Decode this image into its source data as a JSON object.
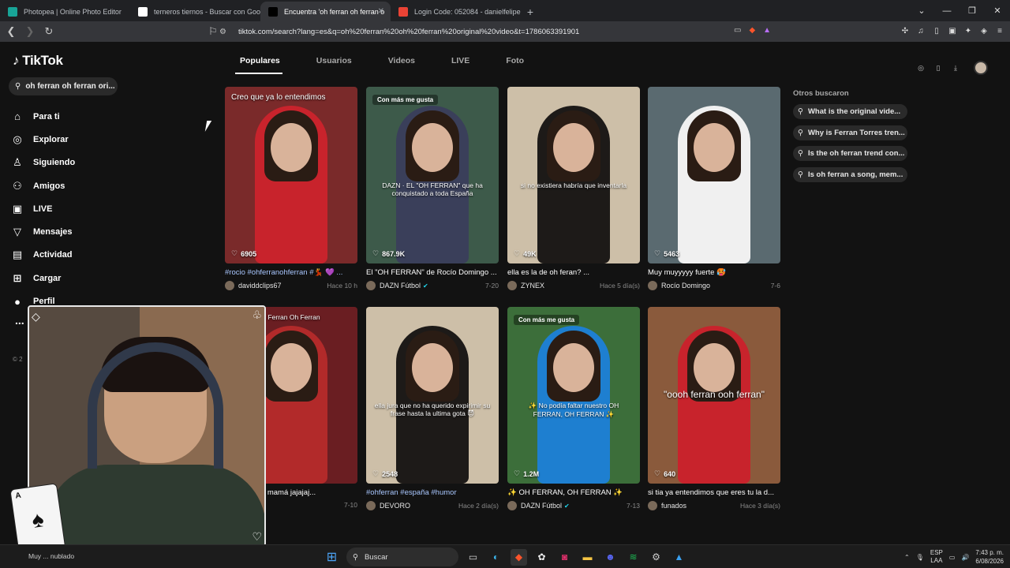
{
  "browser": {
    "tabs": [
      {
        "title": "Photopea | Online Photo Editor",
        "favicon_color": "#18a497",
        "active": false
      },
      {
        "title": "terneros tiernos - Buscar con Google",
        "favicon_color": "#ffffff",
        "active": false
      },
      {
        "title": "Encuentra 'oh ferran oh ferran o",
        "favicon_color": "#000000",
        "active": true
      },
      {
        "title": "Login Code: 052084 - danielfelipega",
        "favicon_color": "#ea4335",
        "active": false
      }
    ],
    "new_tab": "+",
    "url": "tiktok.com/search?lang=es&q=oh%20ferran%20oh%20ferran%20original%20video&t=1786063391901"
  },
  "sidebar": {
    "logo": "TikTok",
    "search_value": "oh ferran oh ferran ori...",
    "items": [
      {
        "label": "Para ti",
        "icon": "home-icon"
      },
      {
        "label": "Explorar",
        "icon": "compass-icon"
      },
      {
        "label": "Siguiendo",
        "icon": "following-icon"
      },
      {
        "label": "Amigos",
        "icon": "friends-icon"
      },
      {
        "label": "LIVE",
        "icon": "live-icon"
      },
      {
        "label": "Mensajes",
        "icon": "messages-icon"
      },
      {
        "label": "Actividad",
        "icon": "activity-icon"
      },
      {
        "label": "Cargar",
        "icon": "upload-icon"
      },
      {
        "label": "Perfil",
        "icon": "profile-icon"
      }
    ],
    "more": "...",
    "footer": "© 2"
  },
  "search_tabs": [
    "Populares",
    "Usuarios",
    "Videos",
    "LIVE",
    "Foto"
  ],
  "videos": [
    {
      "caption": "#rocio #ohferranohferran #💃 💜 ...",
      "user": "daviddclips67",
      "verified": false,
      "date": "Hace 10 h",
      "likes": "6905",
      "badge": "",
      "overlay": "Creo que ya lo entendimos",
      "bg": "#7a2a2a",
      "outfit": "#c8232c"
    },
    {
      "caption": "El \"OH FERRAN\" de Rocío Domingo ...",
      "user": "DAZN Fútbol",
      "verified": true,
      "date": "7-20",
      "likes": "867.9K",
      "badge": "Con más me gusta",
      "overlay": "DAZN · EL \"OH FERRAN\" que ha conquistado a toda España",
      "bg": "#3d5a4a",
      "outfit": "#3a3f5a"
    },
    {
      "caption": "ella es la de oh feran? ...",
      "user": "ZYNEX",
      "verified": false,
      "date": "Hace 5 día(s)",
      "likes": "49K",
      "badge": "",
      "overlay": "si no existiera habría que inventarla",
      "bg": "#cdbfa8",
      "outfit": "#1d1a18"
    },
    {
      "caption": "Muy muyyyyy fuerte 🥵",
      "user": "Rocío Domingo",
      "verified": false,
      "date": "7-6",
      "likes": "5463",
      "badge": "",
      "overlay": "",
      "bg": "#5a6a70",
      "outfit": "#f0f0f0"
    },
    {
      "caption": "o ser casi tu mamá jajajaj...",
      "user": "",
      "verified": false,
      "date": "7-10",
      "likes": "",
      "badge": "",
      "overlay": "h Ferran Oh Ferran",
      "bg": "#6a1e22",
      "outfit": "#b22a2a"
    },
    {
      "caption": "#ohferran #españa #humor",
      "user": "DEVORO",
      "verified": false,
      "date": "Hace 2 día(s)",
      "likes": "2548",
      "badge": "",
      "overlay": "ella jura que no ha querido expirimir su frase hasta la ultima gota 😈",
      "bg": "#cdbfa8",
      "outfit": "#1d1a18"
    },
    {
      "caption": "✨ OH FERRAN, OH FERRAN ✨",
      "user": "DAZN Fútbol",
      "verified": true,
      "date": "7-13",
      "likes": "1.2M",
      "badge": "Con más me gusta",
      "overlay": "✨ No podía faltar nuestro OH FERRAN, OH FERRAN ✨",
      "bg": "#3c6e3a",
      "outfit": "#1e7fd0"
    },
    {
      "caption": "si tia ya entendimos que eres tu la d...",
      "user": "funados",
      "verified": false,
      "date": "Hace 3 día(s)",
      "likes": "640",
      "badge": "",
      "overlay": "\"oooh ferran ooh ferran\"",
      "bg": "#8a5a3c",
      "outfit": "#c8232c"
    }
  ],
  "others": {
    "heading": "Otros buscaron",
    "items": [
      "What is the original vide...",
      "Why is Ferran Torres tren...",
      "Is the oh ferran trend con...",
      "Is oh ferran a song, mem..."
    ]
  },
  "taskbar": {
    "left_text": "Muy ... nublado",
    "search": "Buscar",
    "lang_top": "ESP",
    "lang_bottom": "LAA",
    "time": "7:43 p. m.",
    "date": "6/08/2026"
  }
}
